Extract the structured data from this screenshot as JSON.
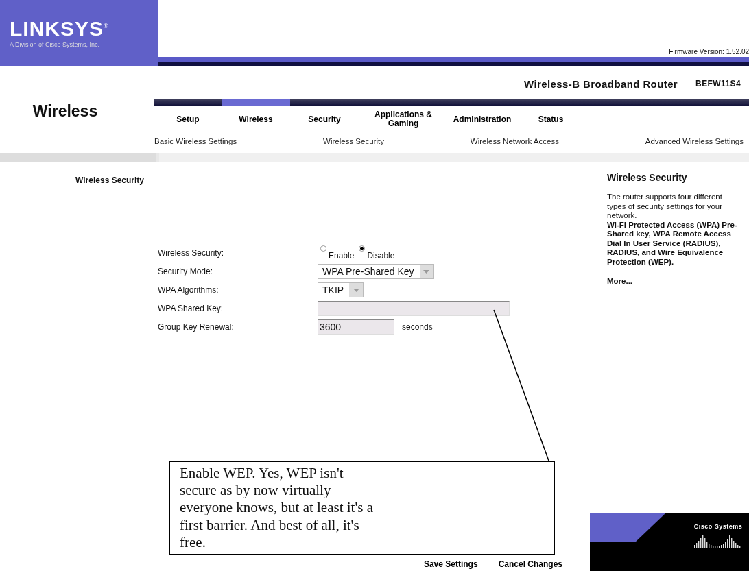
{
  "header": {
    "logo": "LINKSYS",
    "logo_mark": "®",
    "tagline": "A Division of Cisco Systems, Inc.",
    "firmware": "Firmware Version: 1.52.02",
    "product": "Wireless-B Broadband Router",
    "model": "BEFW11S4"
  },
  "section_title": "Wireless",
  "tabs": [
    {
      "label": "Setup",
      "selected": false
    },
    {
      "label": "Wireless",
      "selected": true
    },
    {
      "label": "Security",
      "selected": false
    },
    {
      "label": "Applications & Gaming",
      "selected": false
    },
    {
      "label": "Administration",
      "selected": false
    },
    {
      "label": "Status",
      "selected": false
    }
  ],
  "subtabs": [
    "Basic Wireless Settings",
    "Wireless Security",
    "Wireless Network Access",
    "Advanced Wireless Settings"
  ],
  "sidebar_label": "Wireless Security",
  "form": [
    {
      "kind": "radio",
      "label": "Wireless Security:",
      "options": [
        {
          "label": "Enable",
          "selected": false
        },
        {
          "label": "Disable",
          "selected": true
        }
      ]
    },
    {
      "kind": "select",
      "label": "Security Mode:",
      "value": "WPA Pre-Shared Key"
    },
    {
      "kind": "select",
      "label": "WPA Algorithms:",
      "value": "TKIP"
    },
    {
      "kind": "input",
      "label": "WPA Shared Key:"
    },
    {
      "kind": "input",
      "label": "Group Key Renewal:",
      "value": "3600",
      "unit": "seconds"
    }
  ],
  "help": {
    "title": "Wireless Security",
    "intro": "The router supports four different types of security settings for your network.",
    "details": "Wi-Fi Protected Access (WPA) Pre-Shared key, WPA Remote Access Dial In User Service (RADIUS), RADIUS, and Wire Equivalence Protection (WEP).",
    "more": "More..."
  },
  "buttons": [
    "Save Settings",
    "Cancel Changes"
  ],
  "cisco_logo": "Cisco Systems",
  "callout": "Enable WEP. Yes, WEP isn't secure as by now virtually everyone knows, but at least it's a first barrier. And best of all, it's free."
}
